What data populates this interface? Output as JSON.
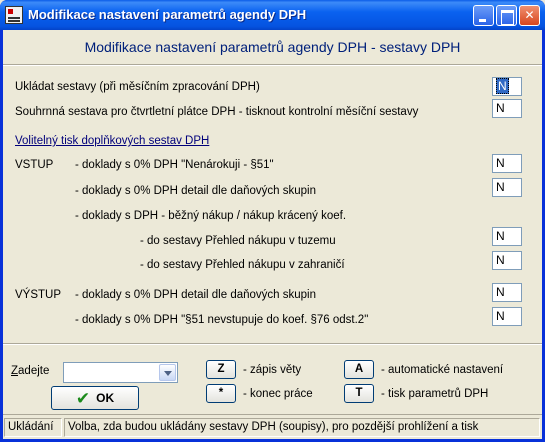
{
  "window": {
    "title": "Modifikace nastavení parametrů agendy DPH"
  },
  "heading": "Modifikace nastavení parametrů agendy DPH - sestavy DPH",
  "options": [
    {
      "label": "Ukládat sestavy (při měsíčním zpracování DPH)",
      "value": "N"
    },
    {
      "label": "Souhrnná sestava pro čtvrtletní plátce DPH - tisknout kontrolní měsíční sestavy",
      "value": "N"
    }
  ],
  "section_title": "Volitelný tisk doplňkových sestav DPH",
  "vstup": {
    "prefix": "VSTUP",
    "row1_label": "- doklady s 0% DPH \"Nenárokuji - §51\"",
    "row1_value": "N",
    "row2_label": "- doklady s 0% DPH detail dle daňových skupin",
    "row2_value": "N",
    "row3_label": "- doklady s DPH - běžný nákup / nákup krácený koef.",
    "sub1_label": "- do sestavy Přehled nákupu v tuzemu",
    "sub1_value": "N",
    "sub2_label": "- do sestavy Přehled nákupu v zahraničí",
    "sub2_value": "N"
  },
  "vystup": {
    "prefix": "VÝSTUP",
    "row1_label": "- doklady s 0% DPH detail dle daňových skupin",
    "row1_value": "N",
    "row2_label": "- doklady s 0% DPH \"§51 nevstupuje do koef. §76 odst.2\"",
    "row2_value": "N"
  },
  "footer": {
    "zadejte_first": "Z",
    "zadejte_rest": "adejte",
    "combo_value": "",
    "ok_label": "OK",
    "keys": [
      {
        "key": "Z",
        "desc": "- zápis věty"
      },
      {
        "key": "*",
        "desc": "- konec práce"
      },
      {
        "key": "A",
        "desc": "- automatické nastavení"
      },
      {
        "key": "T",
        "desc": "- tisk parametrů DPH"
      }
    ]
  },
  "status": {
    "mode": "Ukládání",
    "message": "Volba, zda budou ukládány sestavy DPH (soupisy), pro pozdější prohlížení a tisk"
  },
  "colors": {
    "titlebar": "#0a5ce8",
    "heading": "#00207a",
    "window_bg": "#ece9d8"
  }
}
